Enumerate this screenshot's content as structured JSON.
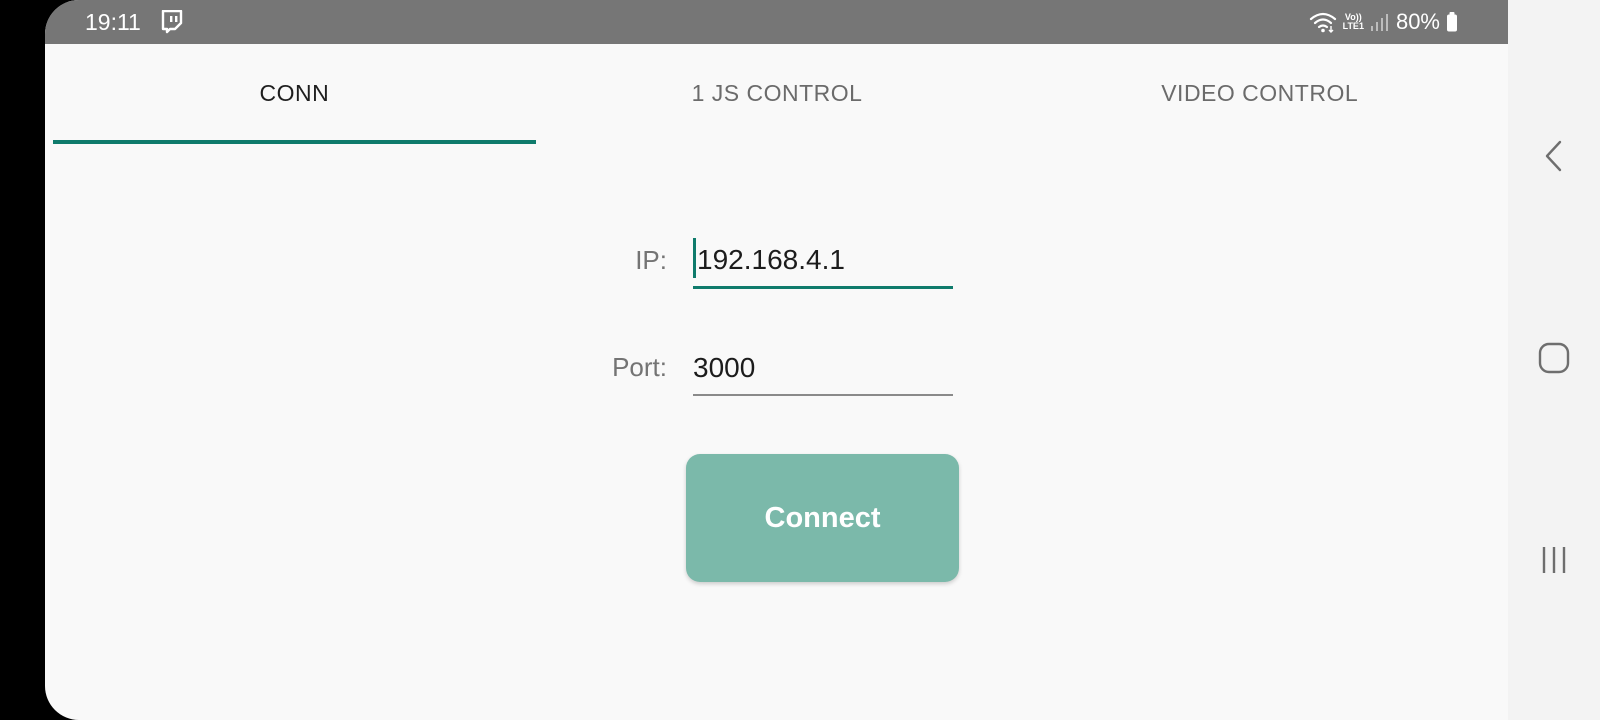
{
  "status_bar": {
    "time": "19:11",
    "notification_icon": "twitch-icon",
    "network_label": "VoLTE1",
    "network_top": "Vo))",
    "network_bottom": "LTE1",
    "battery": "80%"
  },
  "tabs": [
    {
      "label": "CONN",
      "active": true
    },
    {
      "label": "1 JS CONTROL",
      "active": false
    },
    {
      "label": "VIDEO CONTROL",
      "active": false
    }
  ],
  "form": {
    "ip_label": "IP:",
    "ip_value": "192.168.4.1",
    "port_label": "Port:",
    "port_value": "3000"
  },
  "connect_button": {
    "label": "Connect"
  },
  "nav_bar": {
    "back_icon": "back-icon",
    "home_icon": "home-icon",
    "recents_icon": "recents-icon"
  },
  "colors": {
    "accent": "#0f7b6c",
    "button": "#7bb9aa",
    "status_bar": "#767676",
    "background": "#f9f9f9"
  }
}
